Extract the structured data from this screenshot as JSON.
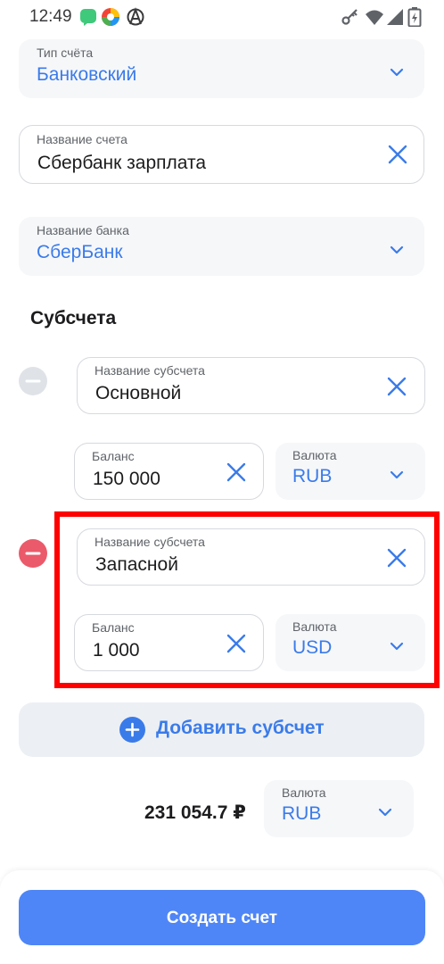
{
  "status_bar": {
    "time": "12:49",
    "icons": [
      "chat-app-icon",
      "colorful-app-icon",
      "anarchy-icon",
      "key-icon",
      "wifi-icon",
      "signal-icon",
      "battery-icon"
    ]
  },
  "account_type": {
    "label": "Тип счёта",
    "value": "Банковский"
  },
  "account_name": {
    "label": "Название счета",
    "value": "Сбербанк зарплата"
  },
  "bank_name": {
    "label": "Название банка",
    "value": "СберБанк"
  },
  "subaccounts_title": "Субсчета",
  "subaccounts": [
    {
      "name_label": "Название субсчета",
      "name_value": "Основной",
      "balance_label": "Баланс",
      "balance_value": "150 000",
      "currency_label": "Валюта",
      "currency_value": "RUB"
    },
    {
      "name_label": "Название субсчета",
      "name_value": "Запасной",
      "balance_label": "Баланс",
      "balance_value": "1 000",
      "currency_label": "Валюта",
      "currency_value": "USD"
    }
  ],
  "add_subaccount": "Добавить субсчет",
  "total": {
    "amount": "231 054.7 ₽",
    "currency_label": "Валюта",
    "currency_value": "RUB"
  },
  "create_button": "Создать счет",
  "colors": {
    "accent": "#3a7bea",
    "button": "#4f86f7",
    "remove_active": "#eb5a6a",
    "remove_inactive": "#dfe3e8",
    "highlight": "#ff0000"
  }
}
